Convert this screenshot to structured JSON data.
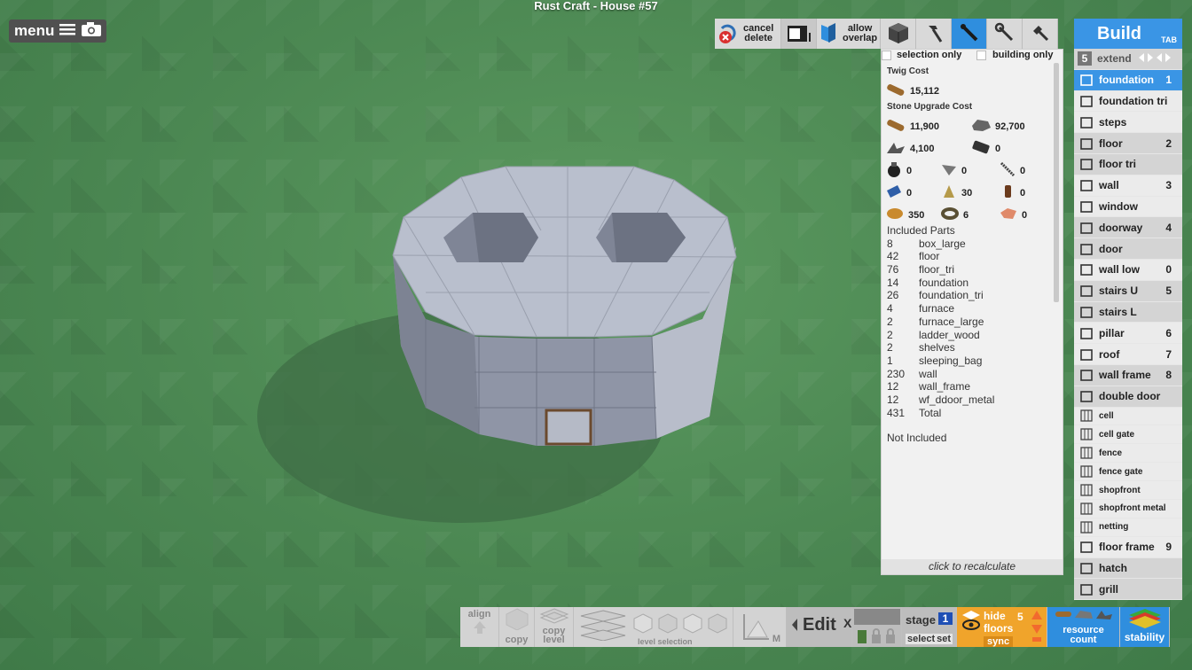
{
  "title": "Rust Craft - House #57",
  "menu": {
    "label": "menu"
  },
  "top_toolbar": {
    "cancel_delete": [
      "cancel",
      "delete"
    ],
    "allow_overlap": [
      "allow",
      "overlap"
    ],
    "selection_only": "selection only",
    "building_only": "building only"
  },
  "cost": {
    "twig_label": "Twig Cost",
    "twig_value": "15,112",
    "stone_label": "Stone Upgrade Cost",
    "stone_items": [
      {
        "icon": "wood-log-icon",
        "value": "11,900"
      },
      {
        "icon": "stone-icon",
        "value": "92,700"
      },
      {
        "icon": "metal-fragments-icon",
        "value": "4,100"
      },
      {
        "icon": "hqm-icon",
        "value": "0"
      },
      {
        "icon": "gunpowder-icon",
        "value": "0"
      },
      {
        "icon": "metal-blade-icon",
        "value": "0"
      },
      {
        "icon": "spring-icon",
        "value": "0"
      },
      {
        "icon": "tarp-icon",
        "value": "0"
      },
      {
        "icon": "cloth-icon",
        "value": "30"
      },
      {
        "icon": "pipe-icon",
        "value": "0"
      },
      {
        "icon": "leather-icon",
        "value": "350"
      },
      {
        "icon": "rope-icon",
        "value": "6"
      },
      {
        "icon": "fabric-icon",
        "value": "0"
      }
    ],
    "included_label": "Included Parts",
    "parts": [
      {
        "count": "8",
        "name": "box_large"
      },
      {
        "count": "42",
        "name": "floor"
      },
      {
        "count": "76",
        "name": "floor_tri"
      },
      {
        "count": "14",
        "name": "foundation"
      },
      {
        "count": "26",
        "name": "foundation_tri"
      },
      {
        "count": "4",
        "name": "furnace"
      },
      {
        "count": "2",
        "name": "furnace_large"
      },
      {
        "count": "2",
        "name": "ladder_wood"
      },
      {
        "count": "2",
        "name": "shelves"
      },
      {
        "count": "1",
        "name": "sleeping_bag"
      },
      {
        "count": "230",
        "name": "wall"
      },
      {
        "count": "12",
        "name": "wall_frame"
      },
      {
        "count": "12",
        "name": "wf_ddoor_metal"
      },
      {
        "count": "431",
        "name": "Total"
      }
    ],
    "not_included_label": "Not Included",
    "recalc": "click to recalculate"
  },
  "build": {
    "title": "Build",
    "tab_key": "TAB",
    "extend_num": "5",
    "extend_label": "extend",
    "items": [
      {
        "label": "foundation",
        "key": "1",
        "icon": "foundation-icon",
        "style": "sel"
      },
      {
        "label": "foundation tri",
        "key": "",
        "icon": "foundation-tri-icon",
        "style": "light"
      },
      {
        "label": "steps",
        "key": "",
        "icon": "steps-icon",
        "style": "light"
      },
      {
        "label": "floor",
        "key": "2",
        "icon": "floor-icon",
        "style": "alt"
      },
      {
        "label": "floor tri",
        "key": "",
        "icon": "floor-tri-icon",
        "style": "alt"
      },
      {
        "label": "wall",
        "key": "3",
        "icon": "wall-icon",
        "style": "light"
      },
      {
        "label": "window",
        "key": "",
        "icon": "window-icon",
        "style": "light"
      },
      {
        "label": "doorway",
        "key": "4",
        "icon": "doorway-icon",
        "style": "alt"
      },
      {
        "label": "door",
        "key": "",
        "icon": "door-icon",
        "style": "alt"
      },
      {
        "label": "wall low",
        "key": "0",
        "icon": "wall-low-icon",
        "style": "light"
      },
      {
        "label": "stairs U",
        "key": "5",
        "icon": "stairs-u-icon",
        "style": "alt"
      },
      {
        "label": "stairs L",
        "key": "",
        "icon": "stairs-l-icon",
        "style": "alt"
      },
      {
        "label": "pillar",
        "key": "6",
        "icon": "pillar-icon",
        "style": "light"
      },
      {
        "label": "roof",
        "key": "7",
        "icon": "roof-icon",
        "style": "light"
      },
      {
        "label": "wall frame",
        "key": "8",
        "icon": "wall-frame-icon",
        "style": "alt"
      },
      {
        "label": "double door",
        "key": "",
        "icon": "double-door-icon",
        "style": "alt"
      }
    ],
    "small_items": [
      {
        "label": "cell",
        "icon": "cell-icon"
      },
      {
        "label": "cell gate",
        "icon": "cell-gate-icon"
      },
      {
        "label": "fence",
        "icon": "fence-icon"
      },
      {
        "label": "fence gate",
        "icon": "fence-gate-icon"
      },
      {
        "label": "shopfront",
        "icon": "shopfront-icon"
      },
      {
        "label": "shopfront metal",
        "icon": "shopfront-metal-icon"
      },
      {
        "label": "netting",
        "icon": "netting-icon"
      }
    ],
    "bottom_items": [
      {
        "label": "floor frame",
        "key": "9",
        "icon": "floor-frame-icon"
      },
      {
        "label": "hatch",
        "key": "",
        "icon": "hatch-icon"
      },
      {
        "label": "grill",
        "key": "",
        "icon": "grill-icon"
      }
    ]
  },
  "bottom_bar": {
    "align": "align",
    "copy": "copy",
    "copy_level": [
      "copy",
      "level"
    ],
    "level_selection": "level selection",
    "m": "M",
    "edit": "Edit",
    "x": "X",
    "stage": "stage",
    "stage_num": "1",
    "select": "select",
    "set": "set",
    "hide_floors": [
      "hide",
      "floors"
    ],
    "floors_num": "5",
    "sync": "sync",
    "resource_count": [
      "resource",
      "count"
    ],
    "stability": "stability"
  },
  "colors": {
    "accent_blue": "#3a95e5",
    "orange": "#f0a42b",
    "grass": "#4e8a55"
  }
}
